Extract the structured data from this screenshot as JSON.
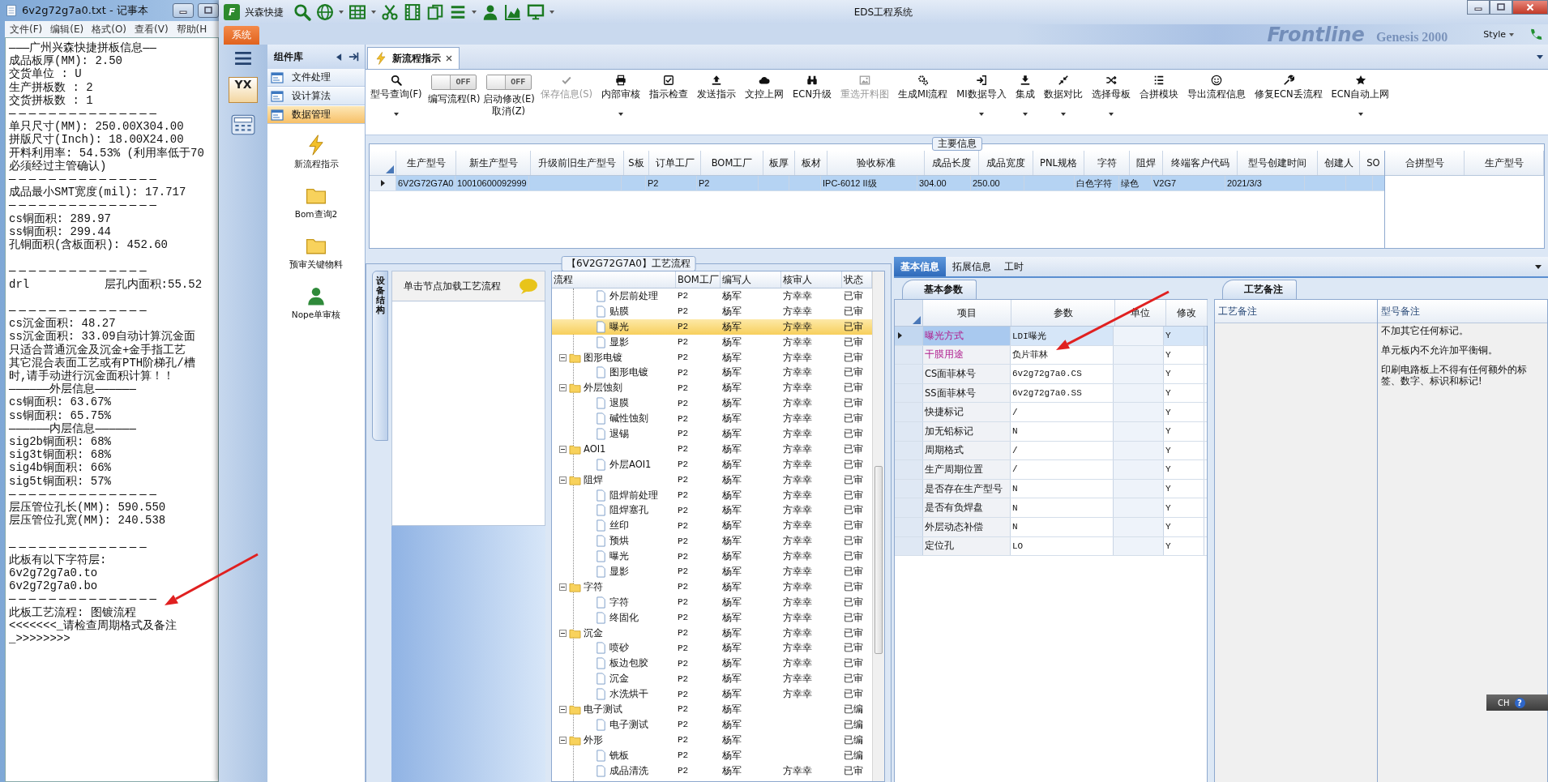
{
  "notepad": {
    "title": "6v2g72g7a0.txt - 记事本",
    "menu": [
      "文件(F)",
      "编辑(E)",
      "格式(O)",
      "查看(V)",
      "帮助(H"
    ],
    "lines": [
      {
        "text": "———广州兴森快捷拼板信息——",
        "kind": "text"
      },
      {
        "text": "成品板厚(MM): 2.50",
        "kind": "text"
      },
      {
        "text": "交货单位 : U",
        "kind": "text"
      },
      {
        "text": "生产拼板数 : 2",
        "kind": "text"
      },
      {
        "text": "交货拼板数 : 1",
        "kind": "text"
      },
      {
        "text": "———————————————",
        "kind": "rule"
      },
      {
        "text": "单只尺寸(MM): 250.00X304.00",
        "kind": "text"
      },
      {
        "text": "拼版尺寸(Inch): 18.00X24.00",
        "kind": "text"
      },
      {
        "text": "开料利用率: 54.53% (利用率低于70",
        "kind": "text"
      },
      {
        "text": "必须经过主管确认)",
        "kind": "text"
      },
      {
        "text": "———————————————",
        "kind": "rule"
      },
      {
        "text": "成品最小SMT宽度(mil): 17.717",
        "kind": "text"
      },
      {
        "text": "———————————————",
        "kind": "rule"
      },
      {
        "text": "cs铜面积: 289.97",
        "kind": "text"
      },
      {
        "text": "ss铜面积: 299.44",
        "kind": "text"
      },
      {
        "text": "孔铜面积(含板面积): 452.60",
        "kind": "text"
      },
      {
        "text": "——————————————",
        "kind": "rule",
        "blank_before": true
      },
      {
        "text": "drl           层孔内面积:55.52",
        "kind": "text"
      },
      {
        "text": "——————————————",
        "kind": "rule",
        "blank_before": true
      },
      {
        "text": "cs沉金面积: 48.27",
        "kind": "text"
      },
      {
        "text": "ss沉金面积: 33.09自动计算沉金面",
        "kind": "text"
      },
      {
        "text": "只适合普通沉金及沉金+金手指工艺",
        "kind": "text"
      },
      {
        "text": "其它混合表面工艺或有PTH阶梯孔/槽",
        "kind": "text"
      },
      {
        "text": "时,请手动进行沉金面积计算！！",
        "kind": "text"
      },
      {
        "text": "——————外层信息——————",
        "kind": "text"
      },
      {
        "text": "cs铜面积: 63.67%",
        "kind": "text"
      },
      {
        "text": "ss铜面积: 65.75%",
        "kind": "text"
      },
      {
        "text": "——————内层信息——————",
        "kind": "text"
      },
      {
        "text": "sig2b铜面积: 68%",
        "kind": "text"
      },
      {
        "text": "sig3t铜面积: 68%",
        "kind": "text"
      },
      {
        "text": "sig4b铜面积: 66%",
        "kind": "text"
      },
      {
        "text": "sig5t铜面积: 57%",
        "kind": "text"
      },
      {
        "text": "———————————————",
        "kind": "rule"
      },
      {
        "text": "层压管位孔长(MM): 590.550",
        "kind": "text"
      },
      {
        "text": "层压管位孔宽(MM): 240.538",
        "kind": "text"
      },
      {
        "text": "——————————————",
        "kind": "rule",
        "blank_before": true
      },
      {
        "text": "此板有以下字符层:",
        "kind": "text"
      },
      {
        "text": "6v2g72g7a0.to",
        "kind": "text"
      },
      {
        "text": "6v2g72g7a0.bo",
        "kind": "text"
      },
      {
        "text": "———————————————",
        "kind": "rule"
      },
      {
        "text": "此板工艺流程: 图镀流程",
        "kind": "text"
      },
      {
        "text": "<<<<<<<_请检查周期格式及备注",
        "kind": "text"
      },
      {
        "text": "_>>>>>>>>",
        "kind": "text"
      }
    ]
  },
  "app": {
    "logo_letter": "F",
    "logo_text": "兴森快捷",
    "title": "EDS工程系统",
    "ribbon_tab": "系统",
    "banner": [
      "Frontline",
      "Genesis 2000"
    ],
    "style_label": "Style"
  },
  "sidebar": {
    "logo_text": "YX",
    "header": "组件库",
    "groups": [
      {
        "label": "文件处理",
        "selected": false
      },
      {
        "label": "设计算法",
        "selected": false
      },
      {
        "label": "数据管理",
        "selected": true
      }
    ],
    "tools": [
      "新流程指示",
      "Bom查询2",
      "预审关键物料",
      "Nope单审核"
    ]
  },
  "tab": {
    "label": "新流程指示"
  },
  "toolbar": [
    {
      "kind": "button",
      "label": "型号查询(F)",
      "dropdown": true,
      "disabled": false
    },
    {
      "kind": "toggle",
      "label": "编写流程(R)",
      "state_text": "OFF",
      "on": false
    },
    {
      "kind": "toggle",
      "label": "启动修改(E)",
      "sublabel": "取消(Z)",
      "state_text": "OFF",
      "on": false
    },
    {
      "kind": "button",
      "label": "保存信息(S)",
      "dropdown": false,
      "disabled": true
    },
    {
      "kind": "button",
      "label": "内部审核",
      "dropdown": true,
      "disabled": false
    },
    {
      "kind": "button",
      "label": "指示检查",
      "dropdown": false,
      "disabled": false
    },
    {
      "kind": "button",
      "label": "发送指示",
      "dropdown": false,
      "disabled": false
    },
    {
      "kind": "button",
      "label": "文控上网",
      "dropdown": false,
      "disabled": false
    },
    {
      "kind": "button",
      "label": "ECN升级",
      "dropdown": false,
      "disabled": false
    },
    {
      "kind": "button",
      "label": "重选开料图",
      "dropdown": false,
      "disabled": true
    },
    {
      "kind": "button",
      "label": "生成MI流程",
      "dropdown": false,
      "disabled": false
    },
    {
      "kind": "button",
      "label": "MI数据导入",
      "dropdown": true,
      "disabled": false
    },
    {
      "kind": "button",
      "label": "集成",
      "dropdown": true,
      "disabled": false
    },
    {
      "kind": "button",
      "label": "数据对比",
      "dropdown": true,
      "disabled": false
    },
    {
      "kind": "button",
      "label": "选择母板",
      "dropdown": true,
      "disabled": false
    },
    {
      "kind": "button",
      "label": "合拼模块",
      "dropdown": false,
      "disabled": false
    },
    {
      "kind": "button",
      "label": "导出流程信息",
      "dropdown": false,
      "disabled": false
    },
    {
      "kind": "button",
      "label": "修复ECN丢流程",
      "dropdown": false,
      "disabled": false
    },
    {
      "kind": "button",
      "label": "ECN自动上网",
      "dropdown": true,
      "disabled": false
    }
  ],
  "main_info": {
    "title": "主要信息",
    "columns": [
      "生产型号",
      "新生产型号",
      "升级前旧生产型号",
      "S板",
      "订单工厂",
      "BOM工厂",
      "板厚",
      "板材",
      "验收标准",
      "成品长度",
      "成品宽度",
      "PNL规格",
      "字符",
      "阻焊",
      "终端客户代码",
      "型号创建时间",
      "创建人",
      "SO"
    ],
    "rows": [
      {
        "selected": true,
        "cells": [
          "6V2G72G7A0",
          "10010600092999",
          null,
          null,
          "P2",
          "P2",
          null,
          null,
          "IPC-6012 II级",
          "304.00",
          "250.00",
          null,
          "白色字符",
          "绿色",
          "V2G7",
          "2021/3/3",
          null,
          null
        ]
      }
    ],
    "side_columns": [
      "合拼型号",
      "生产型号"
    ]
  },
  "process": {
    "title": "【6V2G72G7A0】工艺流程",
    "side_tab": "设备结构",
    "hint": "单击节点加载工艺流程",
    "columns": [
      "流程",
      "BOM工厂",
      "编写人",
      "核审人",
      "状态"
    ],
    "tree": [
      {
        "children": [
          {
            "label": "外层前处理",
            "bom": "P2",
            "writer": "杨军",
            "reviewer": "方幸幸",
            "status": "已审",
            "selected": false
          },
          {
            "label": "贴膜",
            "bom": "P2",
            "writer": "杨军",
            "reviewer": "方幸幸",
            "status": "已审",
            "selected": false
          },
          {
            "label": "曝光",
            "bom": "P2",
            "writer": "杨军",
            "reviewer": "方幸幸",
            "status": "已审",
            "selected": true
          },
          {
            "label": "显影",
            "bom": "P2",
            "writer": "杨军",
            "reviewer": "方幸幸",
            "status": "已审",
            "selected": false
          }
        ]
      },
      {
        "label": "图形电镀",
        "bom": "P2",
        "writer": "杨军",
        "reviewer": "方幸幸",
        "status": "已审",
        "selected": false,
        "expanded": true,
        "children": [
          {
            "label": "图形电镀",
            "bom": "P2",
            "writer": "杨军",
            "reviewer": "方幸幸",
            "status": "已审",
            "selected": false
          }
        ]
      },
      {
        "label": "外层蚀刻",
        "bom": "P2",
        "writer": "杨军",
        "reviewer": "方幸幸",
        "status": "已审",
        "selected": false,
        "expanded": true,
        "children": [
          {
            "label": "退膜",
            "bom": "P2",
            "writer": "杨军",
            "reviewer": "方幸幸",
            "status": "已审",
            "selected": false
          },
          {
            "label": "碱性蚀刻",
            "bom": "P2",
            "writer": "杨军",
            "reviewer": "方幸幸",
            "status": "已审",
            "selected": false
          },
          {
            "label": "退锡",
            "bom": "P2",
            "writer": "杨军",
            "reviewer": "方幸幸",
            "status": "已审",
            "selected": false
          }
        ]
      },
      {
        "label": "AOI1",
        "bom": "P2",
        "writer": "杨军",
        "reviewer": "方幸幸",
        "status": "已审",
        "selected": false,
        "expanded": true,
        "children": [
          {
            "label": "外层AOI1",
            "bom": "P2",
            "writer": "杨军",
            "reviewer": "方幸幸",
            "status": "已审",
            "selected": false
          }
        ]
      },
      {
        "label": "阻焊",
        "bom": "P2",
        "writer": "杨军",
        "reviewer": "方幸幸",
        "status": "已审",
        "selected": false,
        "expanded": true,
        "children": [
          {
            "label": "阻焊前处理",
            "bom": "P2",
            "writer": "杨军",
            "reviewer": "方幸幸",
            "status": "已审",
            "selected": false
          },
          {
            "label": "阻焊塞孔",
            "bom": "P2",
            "writer": "杨军",
            "reviewer": "方幸幸",
            "status": "已审",
            "selected": false
          },
          {
            "label": "丝印",
            "bom": "P2",
            "writer": "杨军",
            "reviewer": "方幸幸",
            "status": "已审",
            "selected": false
          },
          {
            "label": "预烘",
            "bom": "P2",
            "writer": "杨军",
            "reviewer": "方幸幸",
            "status": "已审",
            "selected": false
          },
          {
            "label": "曝光",
            "bom": "P2",
            "writer": "杨军",
            "reviewer": "方幸幸",
            "status": "已审",
            "selected": false
          },
          {
            "label": "显影",
            "bom": "P2",
            "writer": "杨军",
            "reviewer": "方幸幸",
            "status": "已审",
            "selected": false
          }
        ]
      },
      {
        "label": "字符",
        "bom": "P2",
        "writer": "杨军",
        "reviewer": "方幸幸",
        "status": "已审",
        "selected": false,
        "expanded": true,
        "children": [
          {
            "label": "字符",
            "bom": "P2",
            "writer": "杨军",
            "reviewer": "方幸幸",
            "status": "已审",
            "selected": false
          },
          {
            "label": "终固化",
            "bom": "P2",
            "writer": "杨军",
            "reviewer": "方幸幸",
            "status": "已审",
            "selected": false
          }
        ]
      },
      {
        "label": "沉金",
        "bom": "P2",
        "writer": "杨军",
        "reviewer": "方幸幸",
        "status": "已审",
        "selected": false,
        "expanded": true,
        "children": [
          {
            "label": "喷砂",
            "bom": "P2",
            "writer": "杨军",
            "reviewer": "方幸幸",
            "status": "已审",
            "selected": false
          },
          {
            "label": "板边包胶",
            "bom": "P2",
            "writer": "杨军",
            "reviewer": "方幸幸",
            "status": "已审",
            "selected": false
          },
          {
            "label": "沉金",
            "bom": "P2",
            "writer": "杨军",
            "reviewer": "方幸幸",
            "status": "已审",
            "selected": false
          },
          {
            "label": "水洗烘干",
            "bom": "P2",
            "writer": "杨军",
            "reviewer": "方幸幸",
            "status": "已审",
            "selected": false
          }
        ]
      },
      {
        "label": "电子测试",
        "bom": "P2",
        "writer": "杨军",
        "status": "已编",
        "selected": false,
        "expanded": true,
        "children": [
          {
            "label": "电子测试",
            "bom": "P2",
            "writer": "杨军",
            "status": "已编",
            "selected": false
          }
        ]
      },
      {
        "label": "外形",
        "bom": "P2",
        "writer": "杨军",
        "status": "已编",
        "selected": false,
        "expanded": true,
        "children": [
          {
            "label": "铣板",
            "bom": "P2",
            "writer": "杨军",
            "status": "已编",
            "selected": false
          },
          {
            "label": "成品清洗",
            "bom": "P2",
            "writer": "杨军",
            "reviewer": "方幸幸",
            "status": "已审",
            "selected": false
          }
        ]
      }
    ]
  },
  "detail": {
    "tabs": [
      {
        "label": "基本信息",
        "selected": true
      },
      {
        "label": "拓展信息",
        "selected": false
      },
      {
        "label": "工时",
        "selected": false
      }
    ],
    "subtab": "基本参数",
    "columns": [
      "项目",
      "参数",
      "单位",
      "修改"
    ],
    "rows": [
      {
        "item": "曝光方式",
        "value": "LDI曝光",
        "modify": "Y",
        "highlighted": true,
        "selected": true
      },
      {
        "item": "干膜用途",
        "value": "负片菲林",
        "modify": "Y",
        "highlighted": true,
        "selected": false
      },
      {
        "item": "CS面菲林号",
        "value": "6v2g72g7a0.CS",
        "modify": "Y",
        "highlighted": false,
        "selected": false
      },
      {
        "item": "SS面菲林号",
        "value": "6v2g72g7a0.SS",
        "modify": "Y",
        "highlighted": false,
        "selected": false
      },
      {
        "item": "快捷标记",
        "value": "/",
        "modify": "Y",
        "highlighted": false,
        "selected": false
      },
      {
        "item": "加无铅标记",
        "value": "N",
        "modify": "Y",
        "highlighted": false,
        "selected": false
      },
      {
        "item": "周期格式",
        "value": "/",
        "modify": "Y",
        "highlighted": false,
        "selected": false
      },
      {
        "item": "生产周期位置",
        "value": "/",
        "modify": "Y",
        "highlighted": false,
        "selected": false
      },
      {
        "item": "是否存在生产型号",
        "value": "N",
        "modify": "Y",
        "highlighted": false,
        "selected": false
      },
      {
        "item": "是否有负焊盘",
        "value": "N",
        "modify": "Y",
        "highlighted": false,
        "selected": false
      },
      {
        "item": "外层动态补偿",
        "value": "N",
        "modify": "Y",
        "highlighted": false,
        "selected": false
      },
      {
        "item": "定位孔",
        "value": "LO",
        "modify": "Y",
        "highlighted": false,
        "selected": false
      }
    ],
    "notes": {
      "tab": "工艺备注",
      "columns": [
        "工艺备注",
        "型号备注"
      ],
      "remarks": [
        "不加其它任何标记。",
        "单元板内不允许加平衡铜。",
        "印刷电路板上不得有任何额外的标签、数字、标识和标记!"
      ]
    }
  },
  "langbar": {
    "text": "CH",
    "help": "?"
  }
}
